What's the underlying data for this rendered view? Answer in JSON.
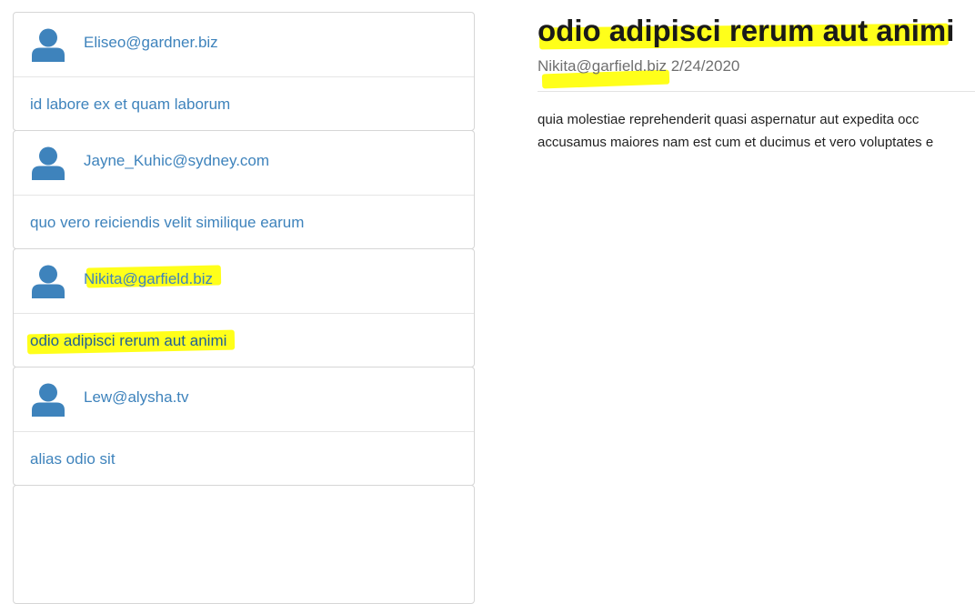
{
  "messages": [
    {
      "author": "Eliseo@gardner.biz",
      "subject": "id labore ex et quam laborum"
    },
    {
      "author": "Jayne_Kuhic@sydney.com",
      "subject": "quo vero reiciendis velit similique earum"
    },
    {
      "author": "Nikita@garfield.biz",
      "subject": "odio adipisci rerum aut animi"
    },
    {
      "author": "Lew@alysha.tv",
      "subject": "alias odio sit"
    }
  ],
  "detail": {
    "title": "odio adipisci rerum aut animi",
    "author": "Nikita@garfield.biz",
    "date": "2/24/2020",
    "body_lines": [
      "quia molestiae reprehenderit quasi aspernatur aut expedita occ",
      "accusamus maiores nam est cum et ducimus et vero voluptates e"
    ]
  },
  "colors": {
    "link": "#3e83bc",
    "avatar": "#3e83bc",
    "highlight": "#ffff1a"
  },
  "icons": {
    "avatar": "user-avatar-icon"
  }
}
